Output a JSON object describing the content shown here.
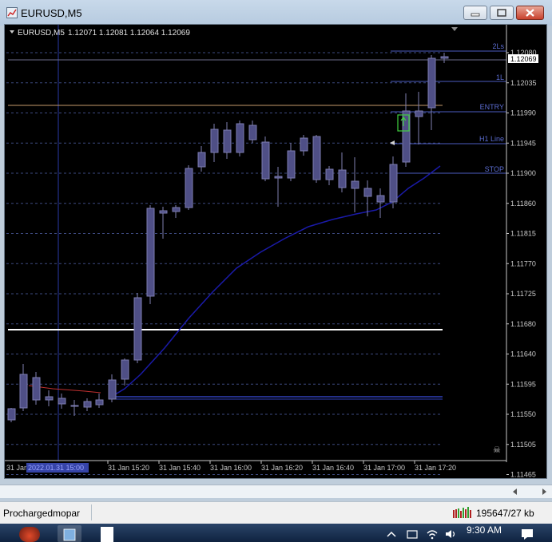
{
  "window": {
    "title": "EURUSD,M5"
  },
  "chart_header": {
    "symbol_tf": "EURUSD,M5",
    "ohlc": "1.12071 1.12081 1.12064 1.12069"
  },
  "price_axis": {
    "ticks": [
      "1.12080",
      "1.12035",
      "1.11990",
      "1.11945",
      "1.11900",
      "1.11860",
      "1.11815",
      "1.11770",
      "1.11725",
      "1.11680",
      "1.11640",
      "1.11595",
      "1.11550",
      "1.11505",
      "1.11465"
    ],
    "current_price": "1.12069"
  },
  "time_axis": {
    "first_label": "31 Jan",
    "highlighted_label": "2022.01.31 15:00",
    "ticks": [
      "31 Jan 15:20",
      "31 Jan 15:40",
      "31 Jan 16:00",
      "31 Jan 16:20",
      "31 Jan 16:40",
      "31 Jan 17:00",
      "31 Jan 17:20"
    ]
  },
  "line_labels": {
    "two_l": "2Ls",
    "one_l": "1L",
    "entry": "ENTRY",
    "h1_line": "H1 Line",
    "stop": "STOP"
  },
  "status": {
    "left": "Prochargedmopar",
    "right": "195647/27 kb"
  },
  "taskbar": {
    "time": "9:30 AM"
  },
  "colors": {
    "background": "#000000",
    "grid": "#3d4a80",
    "candle": "#4f4f86",
    "level_line": "#4c5cc0",
    "entry_line": "#c49a6c",
    "ma": "#1a1aa8"
  }
}
